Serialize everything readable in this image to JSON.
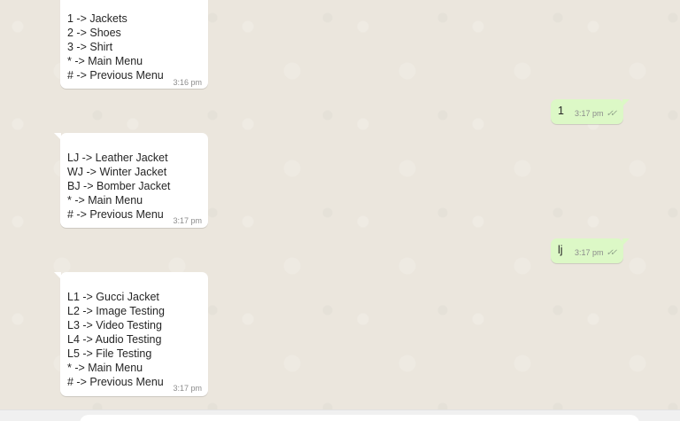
{
  "messages": [
    {
      "direction": "incoming",
      "lines": [
        "1 -> Jackets",
        "2 -> Shoes",
        "3 -> Shirt",
        "* -> Main Menu",
        "# -> Previous Menu"
      ],
      "time": "3:16 pm"
    },
    {
      "direction": "outgoing",
      "text": "1",
      "time": "3:17 pm",
      "status_icon": "double-check-icon"
    },
    {
      "direction": "incoming",
      "lines": [
        "LJ -> Leather Jacket",
        "WJ -> Winter Jacket",
        "BJ -> Bomber Jacket",
        "* -> Main Menu",
        "# -> Previous Menu"
      ],
      "time": "3:17 pm"
    },
    {
      "direction": "outgoing",
      "text": "lj",
      "time": "3:17 pm",
      "status_icon": "double-check-icon"
    },
    {
      "direction": "incoming",
      "lines": [
        "L1 -> Gucci Jacket",
        "L2 -> Image Testing",
        "L3 -> Video Testing",
        "L4 -> Audio Testing",
        "L5 -> File Testing",
        "* -> Main Menu",
        "# -> Previous Menu"
      ],
      "time": "3:17 pm"
    }
  ],
  "colors": {
    "chat_background": "#ebe6dd",
    "incoming_bubble": "#ffffff",
    "outgoing_bubble": "#dcf8c6",
    "timestamp": "#8c8c8c",
    "read_ticks": "#92a58c"
  }
}
